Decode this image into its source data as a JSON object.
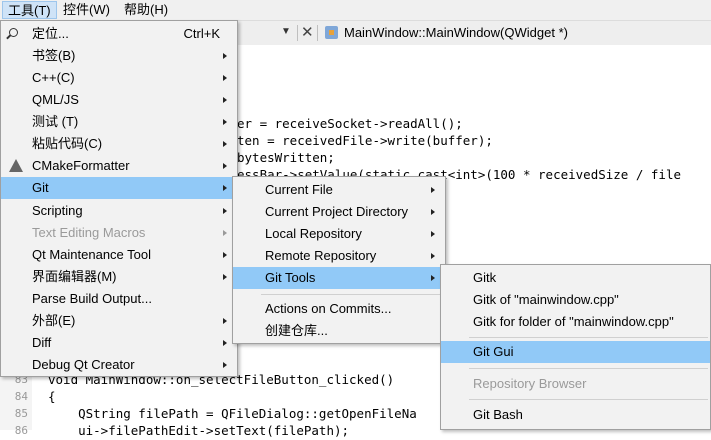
{
  "menubar": {
    "items": [
      {
        "label": "工具(T)"
      },
      {
        "label": "控件(W)"
      },
      {
        "label": "帮助(H)"
      }
    ]
  },
  "editor": {
    "function_label": "MainWindow::MainWindow(QWidget *)"
  },
  "code_lines": [
    {
      "no": "",
      "text": "er = receiveSocket->readAll();"
    },
    {
      "no": "",
      "text": "ten = receivedFile->write(buffer);"
    },
    {
      "no": "",
      "text": "bytesWritten;"
    },
    {
      "no": "",
      "text": "essBar->setValue(static_cast<int>(100 * receivedSize / file"
    },
    {
      "no": "83",
      "text": "void MainWindow::on_selectFileButton_clicked()"
    },
    {
      "no": "84",
      "text": "{"
    },
    {
      "no": "85",
      "text": "    QString filePath = QFileDialog::getOpenFileNa"
    },
    {
      "no": "86",
      "text": "    ui->filePathEdit->setText(filePath);"
    }
  ],
  "tools_menu": {
    "items": [
      {
        "label": "定位...",
        "shortcut": "Ctrl+K",
        "icon": "search-icon"
      },
      {
        "label": "书签(B)"
      },
      {
        "label": "C++(C)"
      },
      {
        "label": "QML/JS"
      },
      {
        "label": "测试 (T)"
      },
      {
        "label": "粘贴代码(C)"
      },
      {
        "label": "CMakeFormatter",
        "icon": "cmake-icon"
      },
      {
        "label": "Git"
      },
      {
        "label": "Scripting"
      },
      {
        "label": "Text Editing Macros"
      },
      {
        "label": "Qt Maintenance Tool"
      },
      {
        "label": "界面编辑器(M)"
      },
      {
        "label": "Parse Build Output..."
      },
      {
        "label": "外部(E)"
      },
      {
        "label": "Diff"
      },
      {
        "label": "Debug Qt Creator"
      }
    ]
  },
  "git_menu": {
    "items": [
      {
        "label": "Current File"
      },
      {
        "label": "Current Project Directory"
      },
      {
        "label": "Local Repository"
      },
      {
        "label": "Remote Repository"
      },
      {
        "label": "Git Tools"
      },
      {
        "label": "Actions on Commits..."
      },
      {
        "label": "创建仓库..."
      }
    ]
  },
  "git_tools_menu": {
    "items": [
      {
        "label": "Gitk"
      },
      {
        "label": "Gitk of \"mainwindow.cpp\""
      },
      {
        "label": "Gitk for folder of \"mainwindow.cpp\""
      },
      {
        "label": "Git Gui"
      },
      {
        "label": "Repository Browser"
      },
      {
        "label": "Git Bash"
      }
    ]
  },
  "colors": {
    "highlight": "#91c9f7",
    "menu_bg": "#f2f2f2",
    "disabled_text": "#9a9a9a"
  }
}
